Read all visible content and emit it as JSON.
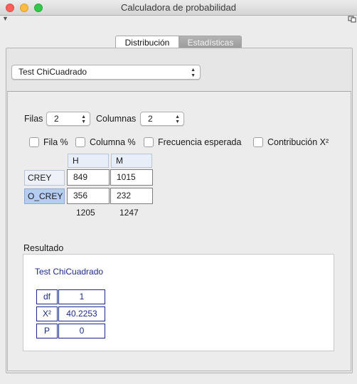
{
  "window": {
    "title": "Calculadora de probabilidad"
  },
  "tabs": [
    {
      "label": "Distribución",
      "active": true
    },
    {
      "label": "Estadísticas",
      "active": false
    }
  ],
  "test_select": {
    "value": "Test ChiCuadrado"
  },
  "dimensions": {
    "rows_label": "Filas",
    "rows_value": "2",
    "cols_label": "Columnas",
    "cols_value": "2"
  },
  "options": [
    {
      "label": "Fila %",
      "checked": false
    },
    {
      "label": "Columna %",
      "checked": false
    },
    {
      "label": "Frecuencia esperada",
      "checked": false
    },
    {
      "label": "Contribución X²",
      "checked": false
    }
  ],
  "table": {
    "col_headers": [
      "H",
      "M"
    ],
    "rows": [
      {
        "label": "CREY",
        "values": [
          "849",
          "1015"
        ]
      },
      {
        "label": "O_CREY",
        "values": [
          "356",
          "232"
        ]
      }
    ],
    "col_totals": [
      "1205",
      "1247"
    ]
  },
  "result": {
    "section_label": "Resultado",
    "title": "Test ChiCuadrado",
    "rows": [
      {
        "name": "df",
        "value": "1"
      },
      {
        "name": "X²",
        "value": "40.2253"
      },
      {
        "name": "P",
        "value": "0"
      }
    ]
  },
  "colors": {
    "result_text": "#1b2a8f",
    "selection": "#b5cdf2",
    "tab_inactive": "#a6a6a6"
  }
}
